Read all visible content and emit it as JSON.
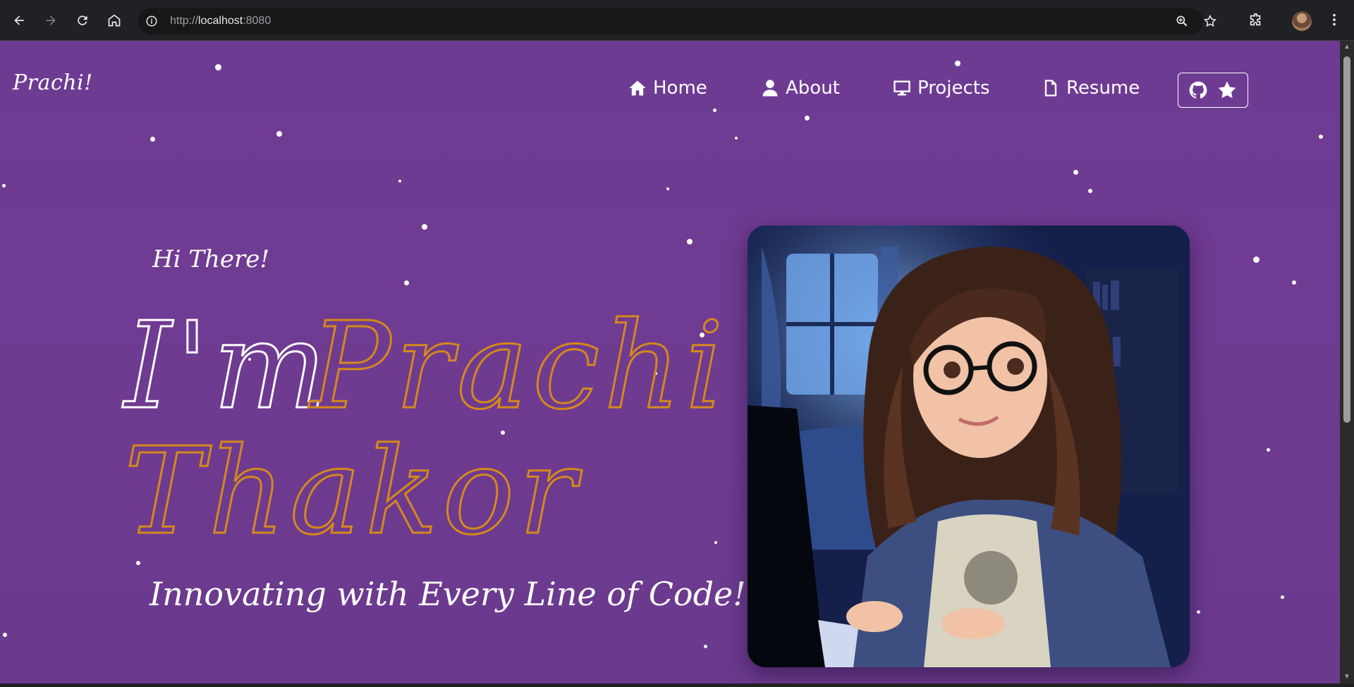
{
  "browser": {
    "url_protocol": "http://",
    "url_host": "localhost",
    "url_port": ":8080"
  },
  "site": {
    "logo": "Prachi!",
    "nav": [
      {
        "label": "Home",
        "icon": "home-icon"
      },
      {
        "label": "About",
        "icon": "user-icon"
      },
      {
        "label": "Projects",
        "icon": "monitor-icon"
      },
      {
        "label": "Resume",
        "icon": "file-icon"
      }
    ],
    "github_button_icons": [
      "github-icon",
      "star-icon"
    ]
  },
  "hero": {
    "greeting": "Hi There!",
    "name_prefix": "I'm",
    "first_name": "Prachi",
    "last_name": "Thakor",
    "tagline": "Innovating with Every Line of Code!",
    "image_description": "Illustrated girl with glasses typing on a laptop in a blue-lit bedroom"
  },
  "colors": {
    "background": "#6e3b93",
    "accent_orange": "#d4891c",
    "text": "#ffffff"
  }
}
